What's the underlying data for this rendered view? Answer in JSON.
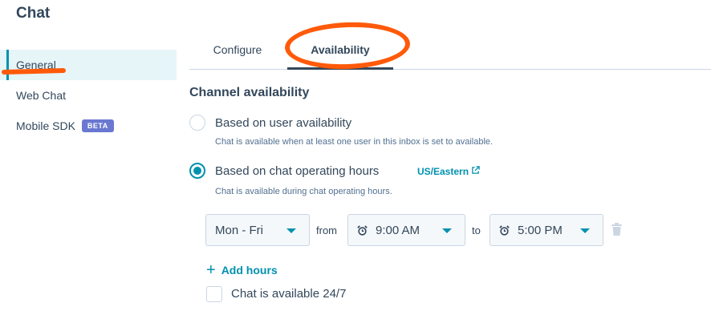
{
  "page": {
    "title": "Chat"
  },
  "sidebar": {
    "items": [
      {
        "label": "General",
        "active": true
      },
      {
        "label": "Web Chat",
        "active": false
      },
      {
        "label": "Mobile SDK",
        "active": false,
        "badge": "BETA"
      }
    ]
  },
  "tabs": [
    {
      "label": "Configure",
      "active": false
    },
    {
      "label": "Availability",
      "active": true
    }
  ],
  "availability": {
    "section_title": "Channel availability",
    "options": [
      {
        "label": "Based on user availability",
        "help": "Chat is available when at least one user in this inbox is set to available.",
        "selected": false
      },
      {
        "label": "Based on chat operating hours",
        "help": "Chat is available during chat operating hours.",
        "selected": true,
        "timezone": "US/Eastern"
      }
    ],
    "hours": {
      "days": "Mon - Fri",
      "from_word": "from",
      "start": "9:00 AM",
      "to_word": "to",
      "end": "5:00 PM"
    },
    "add_hours_label": "Add hours",
    "always_available_label": "Chat is available 24/7",
    "always_available_checked": false
  },
  "colors": {
    "accent": "#0091ae",
    "text": "#33475b",
    "annotation": "#ff5a0a",
    "badge": "#6a78d1"
  },
  "icons": [
    "alarm-clock-icon",
    "caret-down-icon",
    "trash-icon",
    "external-link-icon",
    "plus-icon"
  ]
}
